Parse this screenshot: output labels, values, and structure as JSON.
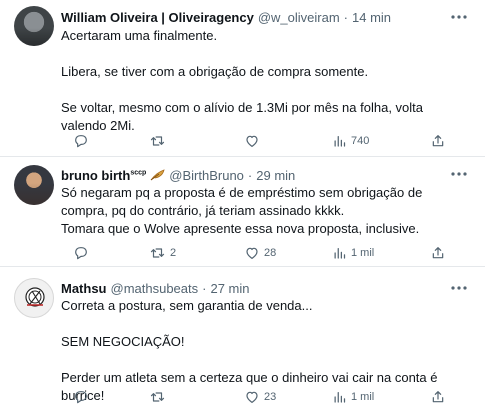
{
  "tweets": [
    {
      "author_name": "William Oliveira | Oliveiragency",
      "handle": "@w_oliveiram",
      "separator": "·",
      "time": "14 min",
      "text": [
        "Acertaram uma finalmente.",
        "Libera, se tiver com a obrigação de compra somente.",
        "Se voltar, mesmo com o alívio de 1.3Mi por mês na folha, volta valendo 2Mi."
      ],
      "stats": {
        "replies": "",
        "retweets": "",
        "likes": "",
        "views": "740"
      }
    },
    {
      "author_name": "bruno birth",
      "name_superscript": "sccp",
      "handle": "@BirthBruno",
      "separator": "·",
      "time": "29 min",
      "text": [
        "Só negaram pq a proposta é de empréstimo sem obrigação de compra, pq do contrário, já teriam assinado kkkk.",
        "Tomara que o Wolve apresente essa nova proposta, inclusive."
      ],
      "stats": {
        "replies": "",
        "retweets": "2",
        "likes": "28",
        "views": "1 mil"
      }
    },
    {
      "author_name": "Mathsu",
      "handle": "@mathsubeats",
      "separator": "·",
      "time": "27 min",
      "text": [
        "Correta a postura, sem garantia de venda...",
        "SEM NEGOCIAÇÃO!",
        "Perder um atleta sem a certeza que o dinheiro vai cair na conta é burrice!"
      ],
      "stats": {
        "replies": "",
        "retweets": "",
        "likes": "23",
        "views": "1 mil"
      }
    }
  ],
  "icons": {
    "more": "more-horizontal-icon",
    "reply": "reply-icon",
    "retweet": "retweet-icon",
    "like": "heart-icon",
    "views": "views-chart-icon",
    "share": "share-icon",
    "feather": "feather-emoji-icon",
    "crest": "club-crest-icon"
  },
  "colors": {
    "text": "#0f1419",
    "secondary": "#536471",
    "divider": "#e5e8eb",
    "background": "#ffffff"
  }
}
